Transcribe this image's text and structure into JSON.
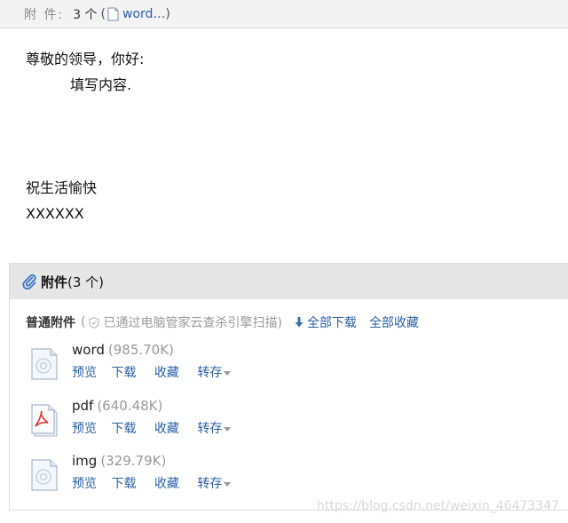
{
  "header": {
    "label": "附 件:",
    "count": "3 个",
    "paren_open": "(",
    "first_file": "word…",
    "paren_close": ")"
  },
  "message": {
    "greeting": "尊敬的领导，你好:",
    "content": "填写内容.",
    "closing": "祝生活愉快",
    "signature": "XXXXXX"
  },
  "attachments": {
    "title": "附件",
    "count": "(3 个)",
    "section_title": "普通附件",
    "scan_note_open": "(",
    "scan_note": "已通过电脑管家云查杀引擎扫描)",
    "download_all": "全部下载",
    "save_all": "全部收藏",
    "files": [
      {
        "name": "word",
        "size": "(985.70K)",
        "icon": "generic-file-icon"
      },
      {
        "name": "pdf",
        "size": "(640.48K)",
        "icon": "pdf-file-icon"
      },
      {
        "name": "img",
        "size": "(329.79K)",
        "icon": "generic-file-icon"
      }
    ],
    "actions": {
      "preview": "预览",
      "download": "下载",
      "favorite": "收藏",
      "save_to": "转存"
    }
  },
  "watermark": "https://blog.csdn.net/weixin_46473347",
  "colors": {
    "link": "#2b5fa5",
    "muted": "#999999",
    "header_bg": "#f3f3f3",
    "panel_head_bg": "#e6e6e6"
  }
}
